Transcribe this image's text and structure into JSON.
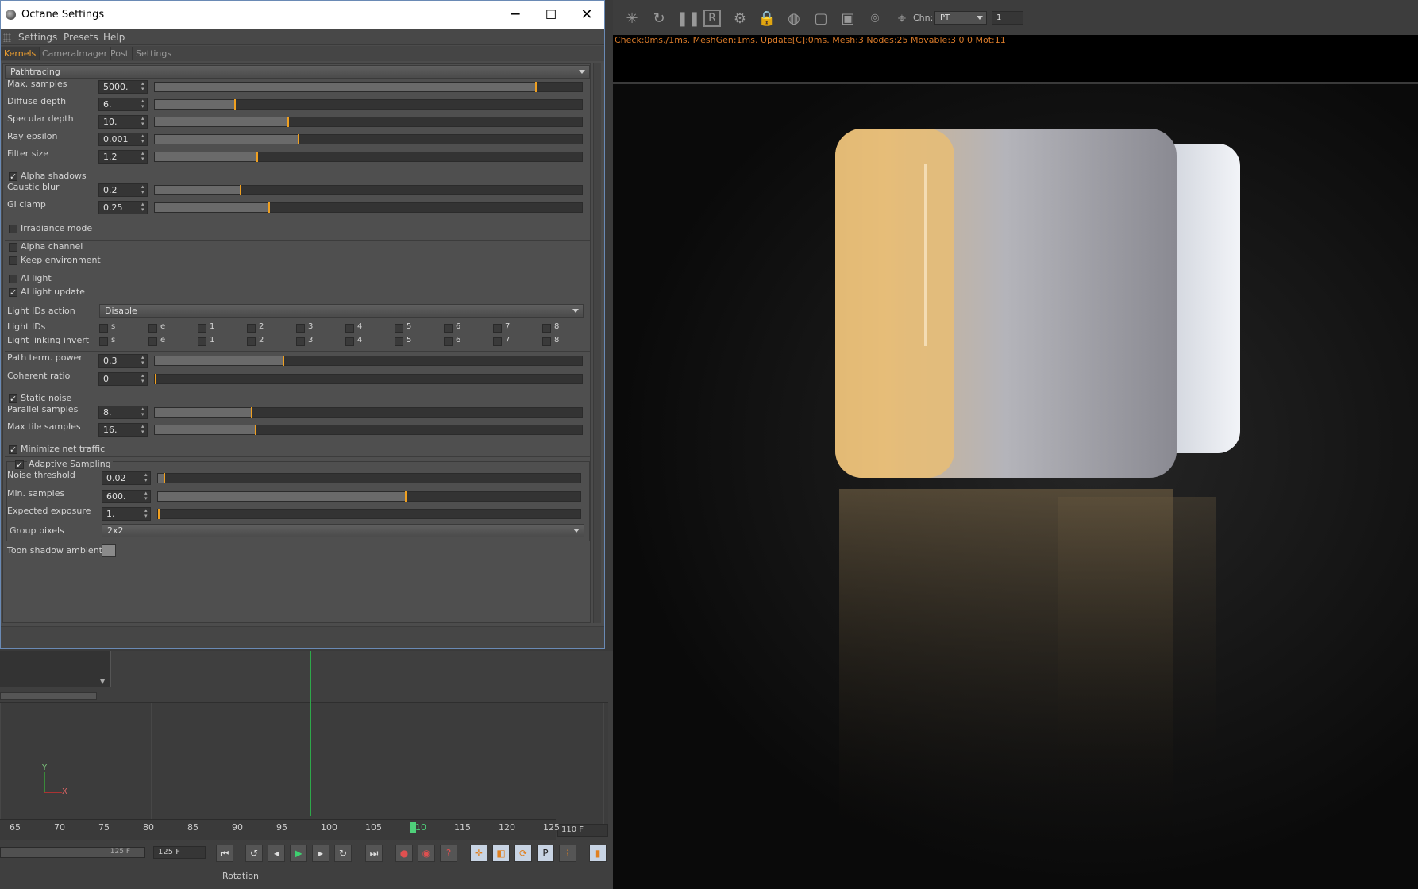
{
  "window": {
    "title": "Octane Settings",
    "min": "─",
    "max": "☐",
    "close": "✕"
  },
  "menu": [
    "Settings",
    "Presets",
    "Help"
  ],
  "tabs": [
    "Kernels",
    "CameraImager",
    "Post",
    "Settings"
  ],
  "kernel": "Pathtracing",
  "sliders1": [
    {
      "label": "Max. samples",
      "value": "5000.",
      "frac": 0.89
    },
    {
      "label": "Diffuse depth",
      "value": "6.",
      "frac": 0.185
    },
    {
      "label": "Specular depth",
      "value": "10.",
      "frac": 0.31
    },
    {
      "label": "Ray epsilon",
      "value": "0.001",
      "frac": 0.335
    },
    {
      "label": "Filter size",
      "value": "1.2",
      "frac": 0.237
    }
  ],
  "alpha_shadows": "Alpha shadows",
  "sliders2": [
    {
      "label": "Caustic blur",
      "value": "0.2",
      "frac": 0.198
    },
    {
      "label": "GI clamp",
      "value": "0.25",
      "frac": 0.265
    }
  ],
  "checks_a": [
    {
      "label": "Irradiance mode",
      "checked": false
    }
  ],
  "checks_b": [
    {
      "label": "Alpha channel",
      "checked": false
    },
    {
      "label": "Keep environment",
      "checked": false
    }
  ],
  "checks_c": [
    {
      "label": "AI light",
      "checked": false
    },
    {
      "label": "AI light update",
      "checked": true
    }
  ],
  "light_ids_action": {
    "label": "Light IDs action",
    "value": "Disable"
  },
  "light_ids": {
    "label": "Light IDs",
    "items": [
      "s",
      "e",
      "1",
      "2",
      "3",
      "4",
      "5",
      "6",
      "7",
      "8"
    ]
  },
  "light_linking": {
    "label": "Light linking invert",
    "items": [
      "s",
      "e",
      "1",
      "2",
      "3",
      "4",
      "5",
      "6",
      "7",
      "8"
    ]
  },
  "sliders3": [
    {
      "label": "Path term. power",
      "value": "0.3",
      "frac": 0.3
    },
    {
      "label": "Coherent ratio",
      "value": "0",
      "frac": 0.0
    }
  ],
  "static_noise": "Static noise",
  "sliders4": [
    {
      "label": "Parallel samples",
      "value": "8.",
      "frac": 0.224
    },
    {
      "label": "Max tile samples",
      "value": "16.",
      "frac": 0.235
    }
  ],
  "min_net": "Minimize net traffic",
  "adaptive": {
    "title": "Adaptive Sampling",
    "sliders": [
      {
        "label": "Noise threshold",
        "value": "0.02",
        "frac": 0.013
      },
      {
        "label": "Min. samples",
        "value": "600.",
        "frac": 0.585
      },
      {
        "label": "Expected exposure",
        "value": "1.",
        "frac": 0.0
      }
    ],
    "group_pixels": {
      "label": "Group pixels",
      "value": "2x2"
    }
  },
  "toon": "Toon shadow ambient",
  "timeline": {
    "ticks": [
      "65",
      "70",
      "75",
      "80",
      "85",
      "90",
      "95",
      "100",
      "105",
      "110",
      "115",
      "120",
      "125"
    ],
    "frame": "110 F",
    "end1": "125 F",
    "end2": "125 F",
    "mode": "Rotation"
  },
  "viewport": {
    "chn_label": "Chn:",
    "chn_value": "PT",
    "num_value": "1",
    "status": "Check:0ms./1ms. MeshGen:1ms. Update[C]:0ms. Mesh:3 Nodes:25 Movable:3  0 0 Mot:11"
  }
}
